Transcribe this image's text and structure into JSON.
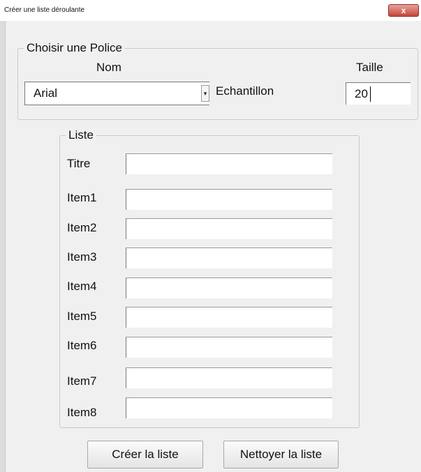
{
  "window": {
    "title": "Créer une liste déroulante",
    "close_symbol": "x"
  },
  "font_group": {
    "legend": "Choisir une Police",
    "name_label": "Nom",
    "size_label": "Taille",
    "sample_label": "Echantillon",
    "font_select": {
      "value": "Arial",
      "arrow": "▾"
    },
    "size_input": {
      "value": "20"
    }
  },
  "list_group": {
    "legend": "Liste",
    "fields": [
      {
        "label": "Titre",
        "value": ""
      },
      {
        "label": "Item1",
        "value": ""
      },
      {
        "label": "Item2",
        "value": ""
      },
      {
        "label": "Item3",
        "value": ""
      },
      {
        "label": "Item4",
        "value": ""
      },
      {
        "label": "Item5",
        "value": ""
      },
      {
        "label": "Item6",
        "value": ""
      },
      {
        "label": "Item7",
        "value": ""
      },
      {
        "label": "Item8",
        "value": ""
      }
    ]
  },
  "buttons": {
    "create": "Créer la liste",
    "clear": "Nettoyer la liste"
  }
}
